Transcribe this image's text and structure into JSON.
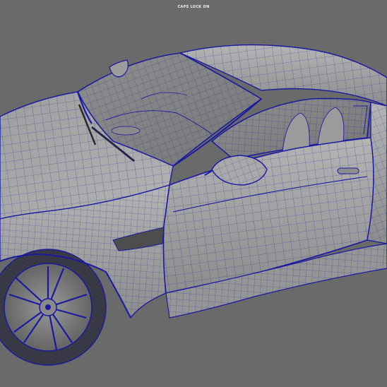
{
  "viewport": {
    "hud_message": "CAPS LOCK ON",
    "background_color": "#6a6a6a",
    "model_shade_color": "#a6a6a6",
    "wireframe_color": "#1a1aa0",
    "display_mode": "wireframe-on-shaded"
  }
}
